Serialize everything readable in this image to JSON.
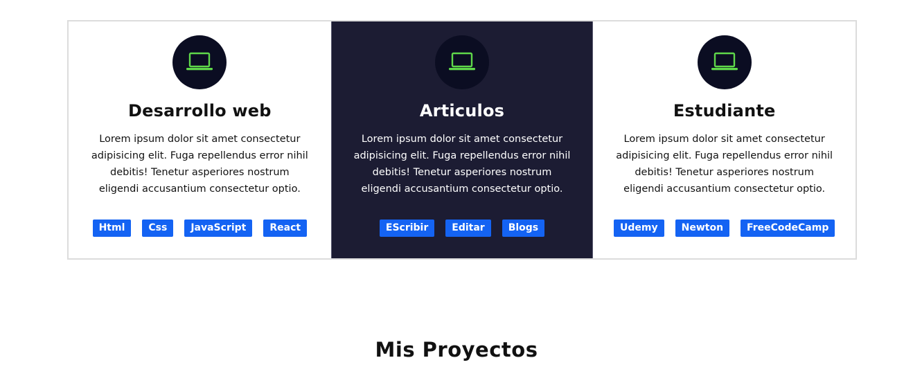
{
  "cards": [
    {
      "title": "Desarrollo web",
      "description": "Lorem ipsum dolor sit amet consectetur adipisicing elit. Fuga repellendus error nihil debitis! Tenetur asperiores nostrum eligendi accusantium consectetur optio.",
      "icon": "laptop-icon",
      "tags": [
        "Html",
        "Css",
        "JavaScript",
        "React"
      ]
    },
    {
      "title": "Articulos",
      "description": "Lorem ipsum dolor sit amet consectetur adipisicing elit. Fuga repellendus error nihil debitis! Tenetur asperiores nostrum eligendi accusantium consectetur optio.",
      "icon": "laptop-icon",
      "tags": [
        "EScribir",
        "Editar",
        "Blogs"
      ]
    },
    {
      "title": "Estudiante",
      "description": "Lorem ipsum dolor sit amet consectetur adipisicing elit. Fuga repellendus error nihil debitis! Tenetur asperiores nostrum eligendi accusantium consectetur optio.",
      "icon": "laptop-icon",
      "tags": [
        "Udemy",
        "Newton",
        "FreeCodeCamp"
      ]
    }
  ],
  "section_title": "Mis Proyectos",
  "colors": {
    "accent": "#1463f3",
    "icon_green": "#5fd84a",
    "dark_card": "#1c1c33",
    "icon_bg": "#0b0d22"
  }
}
